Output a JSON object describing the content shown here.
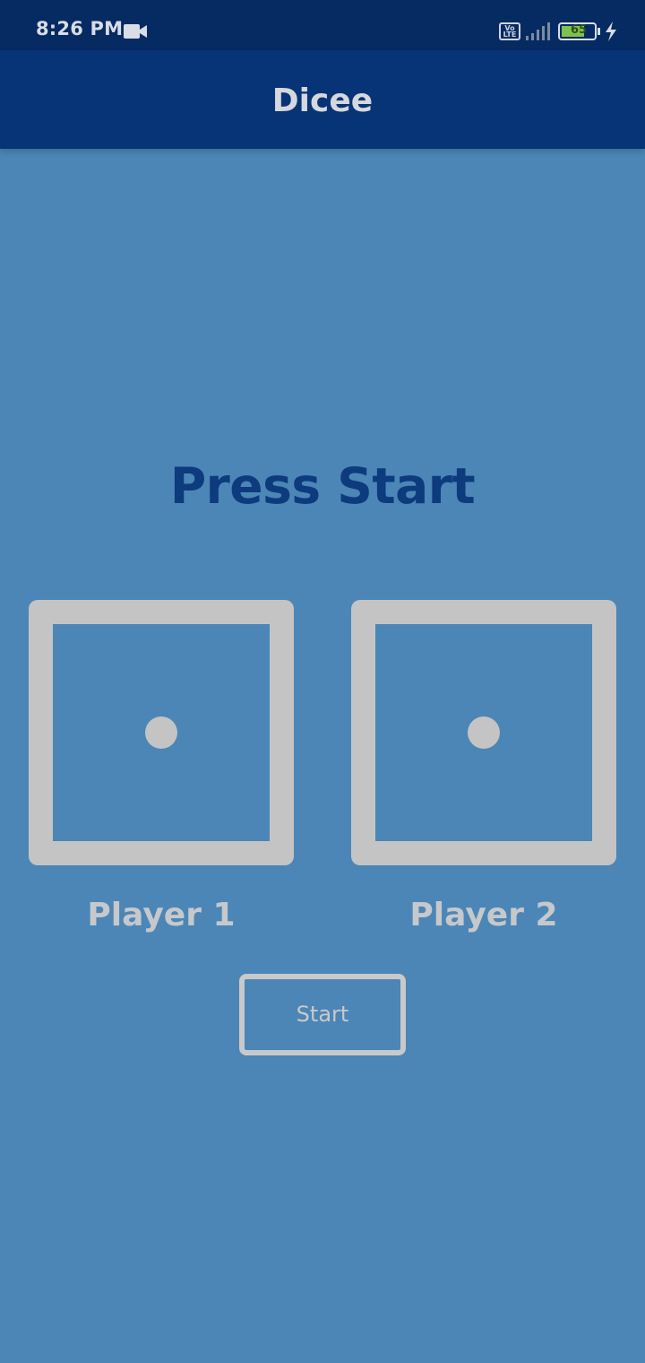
{
  "status_bar": {
    "time": "8:26 PM",
    "video_icon": "video-camera-icon",
    "volte_label": "Vo\nLTE",
    "signal_icon": "signal-icon",
    "battery_level": "65",
    "charging_icon": "lightning-bolt-icon"
  },
  "app_bar": {
    "title": "Dicee"
  },
  "main": {
    "headline": "Press Start",
    "dice": [
      {
        "value": 1
      },
      {
        "value": 1
      }
    ],
    "players": [
      {
        "label": "Player 1"
      },
      {
        "label": "Player 2"
      }
    ],
    "start_button": {
      "label": "Start"
    }
  },
  "colors": {
    "background": "#4b86b6",
    "status_bar": "#062a62",
    "app_bar": "#073476",
    "headline": "#0d3b7d",
    "die": "#c4c4c4",
    "label": "#c6c8cb"
  }
}
